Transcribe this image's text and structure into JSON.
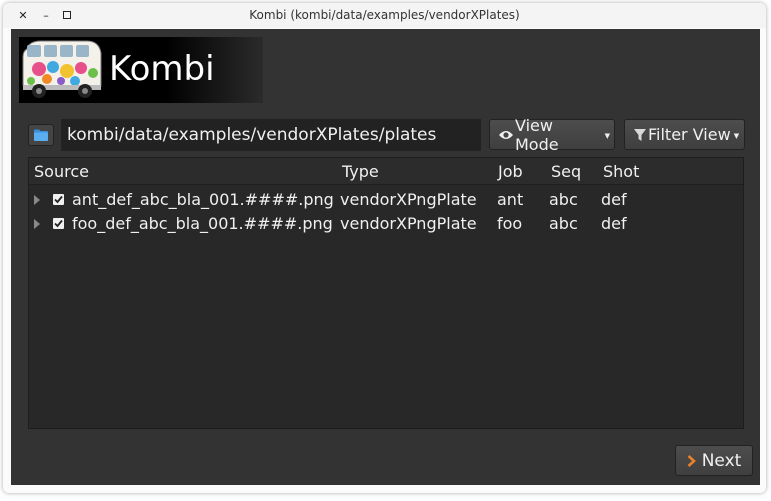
{
  "window": {
    "title": "Kombi (kombi/data/examples/vendorXPlates)",
    "close_glyph": "✕",
    "minimize_glyph": "–",
    "maximize_glyph": "▫"
  },
  "banner": {
    "app_name": "Kombi",
    "logo_icon": "vw-bus-logo"
  },
  "toolbar": {
    "folder_icon": "folder-icon",
    "path_value": "kombi/data/examples/vendorXPlates/plates",
    "view_mode_label": "View Mode",
    "view_mode_icon": "eye-icon",
    "filter_view_label": "Filter View",
    "filter_view_icon": "funnel-icon"
  },
  "tree": {
    "columns": [
      "Source",
      "Type",
      "Job",
      "Seq",
      "Shot"
    ],
    "rows": [
      {
        "source": "ant_def_abc_bla_001.####.png",
        "type": "vendorXPngPlate",
        "job": "ant",
        "seq": "abc",
        "shot": "def",
        "checked": true
      },
      {
        "source": "foo_def_abc_bla_001.####.png",
        "type": "vendorXPngPlate",
        "job": "foo",
        "seq": "abc",
        "shot": "def",
        "checked": true
      }
    ]
  },
  "footer": {
    "next_label": "Next"
  },
  "colors": {
    "client_bg": "#333333",
    "tree_bg": "#282828",
    "accent_orange": "#e8822a",
    "folder_blue": "#3a8fd9"
  }
}
